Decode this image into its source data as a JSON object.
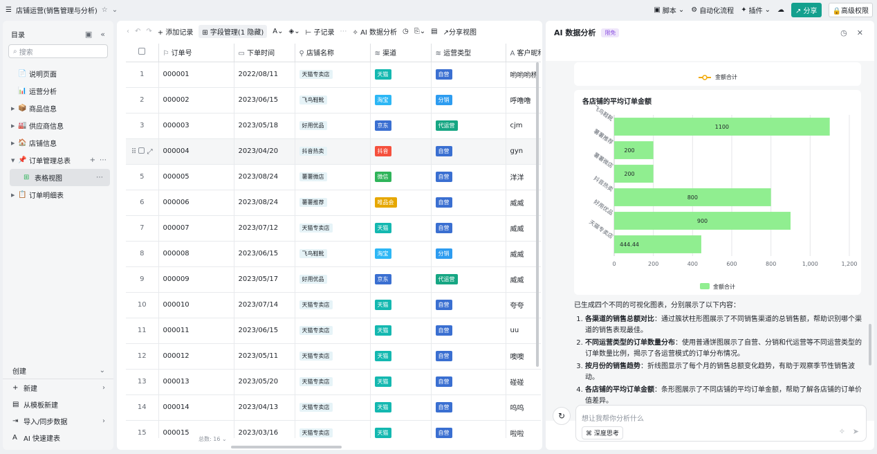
{
  "topbar": {
    "doc_title": "店铺运营(销售管理与分析)",
    "script": "脚本",
    "automation": "自动化流程",
    "plugins": "插件",
    "share": "分享",
    "permissions": "高级权限"
  },
  "sidebar": {
    "title": "目录",
    "search_placeholder": "搜索",
    "items": [
      {
        "label": "说明页面",
        "icon": "📄",
        "arrow": ""
      },
      {
        "label": "运营分析",
        "icon": "📊",
        "arrow": ""
      },
      {
        "label": "商品信息",
        "icon": "📦",
        "arrow": "▶"
      },
      {
        "label": "供应商信息",
        "icon": "🏭",
        "arrow": "▶"
      },
      {
        "label": "店铺信息",
        "icon": "🏠",
        "arrow": "▶"
      },
      {
        "label": "订单管理总表",
        "icon": "📌",
        "arrow": "▼"
      }
    ],
    "active_view": "表格视图",
    "after_item": {
      "label": "订单明细表",
      "icon": "📋",
      "arrow": "▶"
    },
    "create_label": "创建",
    "bottom": [
      {
        "label": "新建",
        "icon": "+"
      },
      {
        "label": "从模板新建",
        "icon": "▤"
      },
      {
        "label": "导入/同步数据",
        "icon": "⇥"
      },
      {
        "label": "AI 快速建表",
        "icon": "A"
      }
    ]
  },
  "toolbar": {
    "add_record": "添加记录",
    "field_manage": "字段管理(1 隐藏)",
    "sub_record": "子记录",
    "ai_analysis": "AI 数据分析",
    "share_view": "分享视图"
  },
  "table": {
    "columns": [
      "订单号",
      "下单时间",
      "店铺名称",
      "渠道",
      "运营类型",
      "客户昵称"
    ],
    "rows": [
      {
        "n": "1",
        "id": "000001",
        "date": "2022/08/11",
        "store": "天猫专卖店",
        "channel": "天猫",
        "type": "自营",
        "customer": "哟哟哟杨"
      },
      {
        "n": "2",
        "id": "000002",
        "date": "2023/06/15",
        "store": "飞鸟鞋靴",
        "channel": "淘宝",
        "type": "分销",
        "customer": "呼噜噜"
      },
      {
        "n": "3",
        "id": "000003",
        "date": "2023/05/18",
        "store": "好用优品",
        "channel": "京东",
        "type": "代运营",
        "customer": "cjm"
      },
      {
        "n": "",
        "id": "000004",
        "date": "2023/04/20",
        "store": "抖音热卖",
        "channel": "抖音",
        "type": "自营",
        "customer": "gyn"
      },
      {
        "n": "5",
        "id": "000005",
        "date": "2023/08/24",
        "store": "薯薯微店",
        "channel": "微信",
        "type": "自营",
        "customer": "洋洋"
      },
      {
        "n": "6",
        "id": "000006",
        "date": "2023/08/24",
        "store": "薯薯推荐",
        "channel": "唯品会",
        "type": "自营",
        "customer": "威威"
      },
      {
        "n": "7",
        "id": "000007",
        "date": "2023/07/12",
        "store": "天猫专卖店",
        "channel": "天猫",
        "type": "自营",
        "customer": "威威"
      },
      {
        "n": "8",
        "id": "000008",
        "date": "2023/06/15",
        "store": "飞鸟鞋靴",
        "channel": "淘宝",
        "type": "分销",
        "customer": "威威"
      },
      {
        "n": "9",
        "id": "000009",
        "date": "2023/05/17",
        "store": "好用优品",
        "channel": "京东",
        "type": "代运营",
        "customer": "威威"
      },
      {
        "n": "10",
        "id": "000010",
        "date": "2023/07/14",
        "store": "天猫专卖店",
        "channel": "天猫",
        "type": "自营",
        "customer": "夸夸"
      },
      {
        "n": "11",
        "id": "000011",
        "date": "2023/06/15",
        "store": "天猫专卖店",
        "channel": "天猫",
        "type": "自营",
        "customer": "uu"
      },
      {
        "n": "12",
        "id": "000012",
        "date": "2023/05/11",
        "store": "天猫专卖店",
        "channel": "天猫",
        "type": "自营",
        "customer": "噢噢"
      },
      {
        "n": "13",
        "id": "000013",
        "date": "2023/05/20",
        "store": "天猫专卖店",
        "channel": "天猫",
        "type": "自营",
        "customer": "碰碰"
      },
      {
        "n": "14",
        "id": "000014",
        "date": "2023/04/13",
        "store": "天猫专卖店",
        "channel": "天猫",
        "type": "自营",
        "customer": "呜呜"
      },
      {
        "n": "15",
        "id": "000015",
        "date": "2023/03/16",
        "store": "天猫专卖店",
        "channel": "天猫",
        "type": "自营",
        "customer": "啦啦"
      }
    ],
    "footer_count": "总数: 16"
  },
  "colors": {
    "天猫": "#14b8b0",
    "淘宝": "#2db7f5",
    "京东": "#3a6fd1",
    "抖音": "#f5503d",
    "微信": "#2fb45a",
    "唯品会": "#e6a700",
    "自营": "#3a6fd1",
    "分销": "#2d9cf0",
    "代运营": "#16a683",
    "bar": "#90ee90"
  },
  "ai": {
    "title": "AI 数据分析",
    "badge": "限免",
    "prev_legend": "金额合计",
    "chart_title": "各店铺的平均订单金额",
    "summary_intro": "已生成四个不同的可视化图表，分别展示了以下内容：",
    "summary_items": [
      {
        "title": "各渠道的销售总额对比",
        "text": "：通过簇状柱形图展示了不同销售渠道的总销售额，帮助识别哪个渠道的销售表现最佳。"
      },
      {
        "title": "不同运营类型的订单数量分布",
        "text": "：使用普通饼图展示了自营、分销和代运营等不同运营类型的订单数量比例，揭示了各运营模式的订单分布情况。"
      },
      {
        "title": "按月份的销售趋势",
        "text": "：折线图显示了每个月的销售总额变化趋势，有助于观察季节性销售波动。"
      },
      {
        "title": "各店铺的平均订单金额",
        "text": "：条形图展示了不同店铺的平均订单金额，帮助了解各店铺的订单价值差异。"
      }
    ],
    "input_placeholder": "想让我帮你分析什么",
    "deep_think": "深度思考"
  },
  "chart_data": {
    "type": "bar",
    "orientation": "horizontal",
    "title": "各店铺的平均订单金额",
    "categories": [
      "飞鸟鞋靴",
      "薯薯推荐",
      "薯薯微店",
      "抖音热卖",
      "好用优品",
      "天猫专卖店"
    ],
    "series": [
      {
        "name": "金额合计",
        "values": [
          1100,
          200,
          200,
          800,
          900,
          444.44
        ]
      }
    ],
    "xticks": [
      "0",
      "200",
      "400",
      "600",
      "800",
      "1,000",
      "1,200"
    ],
    "xlim": [
      0,
      1200
    ],
    "legend": "bottom",
    "grid": true
  }
}
